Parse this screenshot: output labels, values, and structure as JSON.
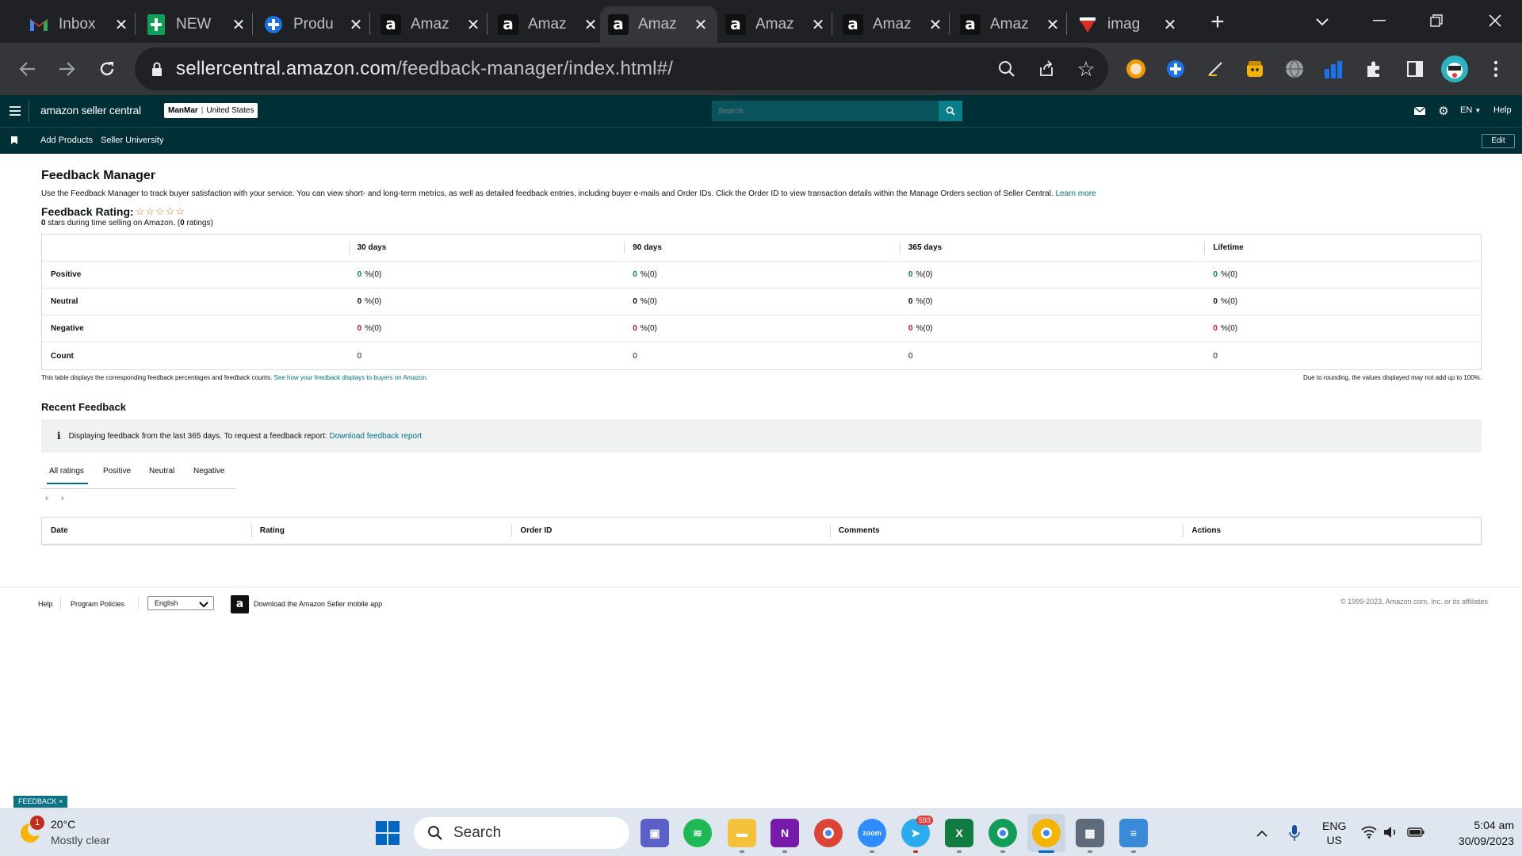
{
  "browser": {
    "tabs": [
      {
        "title": "Inbox",
        "icon": "gmail-icon"
      },
      {
        "title": "NEW",
        "icon": "sheets-icon"
      },
      {
        "title": "Produ",
        "icon": "product-icon"
      },
      {
        "title": "Amaz",
        "icon": "amazon-icon"
      },
      {
        "title": "Amaz",
        "icon": "amazon-icon"
      },
      {
        "title": "Amaz",
        "icon": "amazon-icon"
      },
      {
        "title": "Amaz",
        "icon": "amazon-icon"
      },
      {
        "title": "Amaz",
        "icon": "amazon-icon"
      },
      {
        "title": "Amaz",
        "icon": "amazon-icon"
      },
      {
        "title": "imag",
        "icon": "image-site-icon"
      }
    ],
    "url_domain": "sellercentral.amazon.com",
    "url_path": "/feedback-manager/index.html#/"
  },
  "seller": {
    "logo_text": "amazon seller central",
    "account": "ManMar",
    "marketplace": "United States",
    "search_placeholder": "Search",
    "language": "EN",
    "help": "Help",
    "nav": [
      "Add Products",
      "Seller University"
    ],
    "edit": "Edit"
  },
  "page": {
    "title": "Feedback Manager",
    "intro": "Use the Feedback Manager to track buyer satisfaction with your service. You can view short- and long-term metrics, as well as detailed feedback entries, including buyer e-mails and Order IDs. Click the Order ID to view transaction details within the Manage Orders section of Seller Central.",
    "learn_more": "Learn more",
    "rating_label": "Feedback Rating:",
    "stars_value": 0,
    "stars_max": 5,
    "stars_count": "0",
    "stars_text": "stars during time selling on Amazon. (",
    "ratings_count": "0",
    "ratings_text": "ratings)"
  },
  "feedback_table": {
    "columns": [
      "30 days",
      "90 days",
      "365 days",
      "Lifetime"
    ],
    "rows": [
      {
        "label": "Positive",
        "num": "0",
        "suffix": "%(0)",
        "color": "#067d62"
      },
      {
        "label": "Neutral",
        "num": "0",
        "suffix": "%(0)",
        "color": "#0f1111"
      },
      {
        "label": "Negative",
        "num": "0",
        "suffix": "%(0)",
        "color": "#cc0c39"
      }
    ],
    "count_label": "Count",
    "count_value": "0",
    "note": "This table displays the corresponding feedback percentages and feedback counts.",
    "note_link": "See how your feedback displays to buyers on Amazon.",
    "rounding_note": "Due to rounding, the values displayed may not add up to 100%."
  },
  "recent": {
    "title": "Recent Feedback",
    "info": "Displaying feedback from the last 365 days. To request a feedback report:",
    "info_link": "Download feedback report",
    "tabs": [
      "All ratings",
      "Positive",
      "Neutral",
      "Negative"
    ],
    "columns": [
      "Date",
      "Rating",
      "Order ID",
      "Comments",
      "Actions"
    ]
  },
  "footer": {
    "help": "Help",
    "policies": "Program Policies",
    "language": "English",
    "app": "Download the Amazon Seller mobile app",
    "copyright": "© 1999-2023, Amazon.com, Inc. or its affiliates",
    "feedback_badge": "FEEDBACK"
  },
  "taskbar": {
    "temperature": "20°C",
    "weather": "Mostly clear",
    "weather_badge": "1",
    "search": "Search",
    "telegram_badge": "593",
    "lang1": "ENG",
    "lang2": "US",
    "time": "5:04 am",
    "date": "30/09/2023"
  }
}
